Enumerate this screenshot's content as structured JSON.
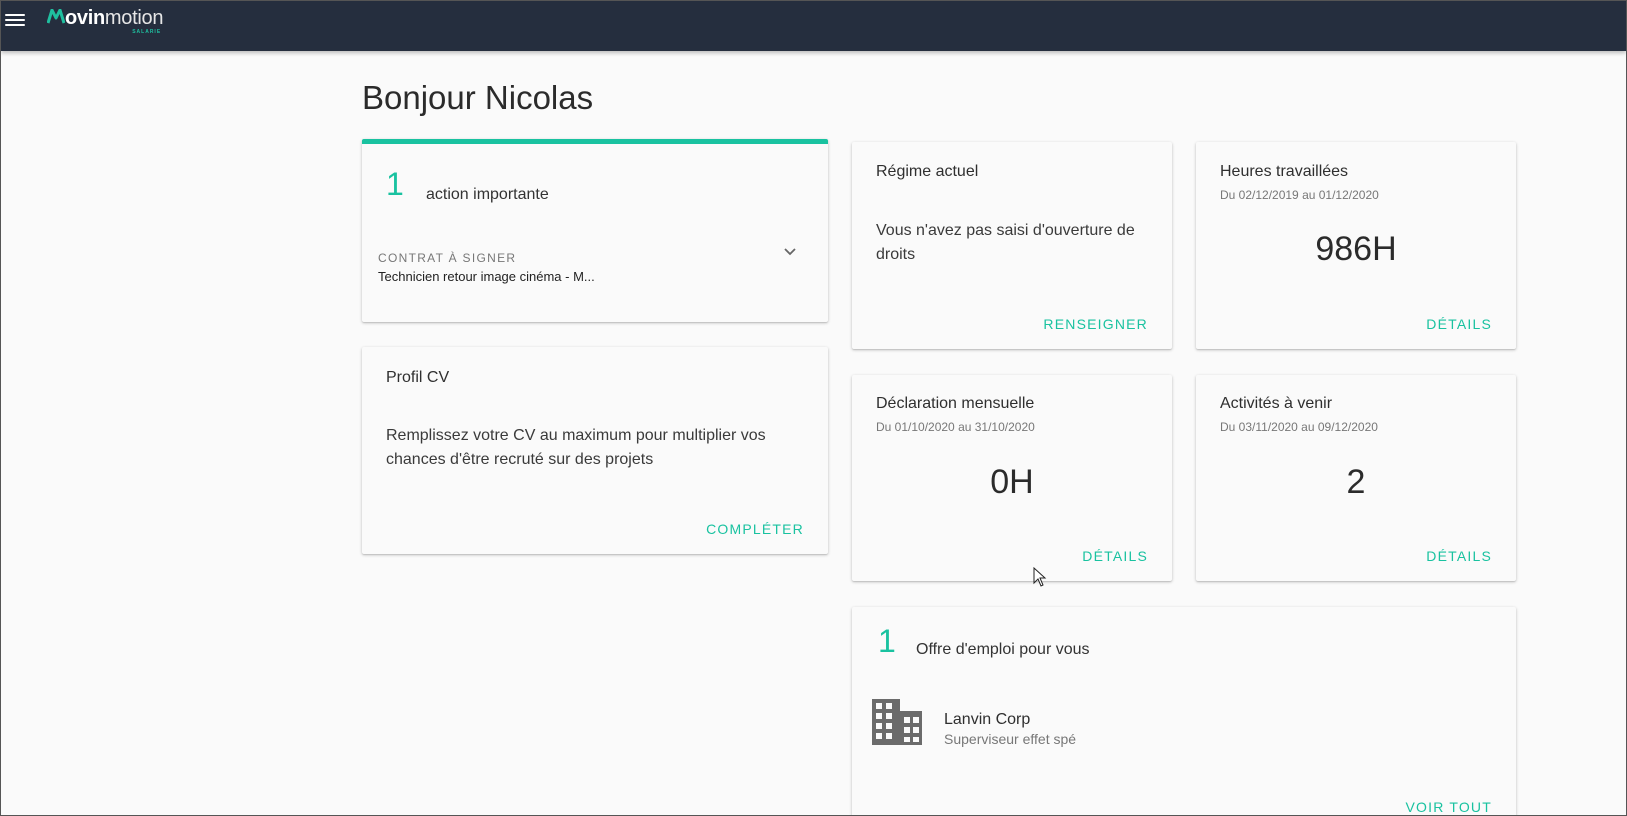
{
  "header": {
    "logo": {
      "part_bold": "ovin",
      "part_light": "motion",
      "sub": "SALARIE"
    },
    "colors": {
      "background": "#252e3e",
      "accent": "#19c2a0"
    }
  },
  "page": {
    "title": "Bonjour Nicolas"
  },
  "actions_card": {
    "count": "1",
    "label": "action importante",
    "item": {
      "eyebrow": "CONTRAT À SIGNER",
      "text": "Technicien retour image cinéma - M..."
    }
  },
  "cv_card": {
    "title": "Profil CV",
    "text": "Remplissez votre CV au maximum pour multiplier vos chances d'être recruté sur des projets",
    "action": "COMPLÉTER"
  },
  "regime_card": {
    "title": "Régime actuel",
    "text": "Vous n'avez pas saisi d'ouverture de droits",
    "action": "RENSEIGNER"
  },
  "hours_card": {
    "title": "Heures travaillées",
    "period": "Du 02/12/2019 au 01/12/2020",
    "value": "986H",
    "action": "DÉTAILS"
  },
  "declaration_card": {
    "title": "Déclaration mensuelle",
    "period": "Du 01/10/2020 au 31/10/2020",
    "value": "0H",
    "action": "DÉTAILS"
  },
  "activities_card": {
    "title": "Activités à venir",
    "period": "Du 03/11/2020 au 09/12/2020",
    "value": "2",
    "action": "DÉTAILS"
  },
  "jobs_card": {
    "count": "1",
    "label": "Offre d'emploi pour vous",
    "offer": {
      "company": "Lanvin Corp",
      "title": "Superviseur effet spé",
      "icon": "building-icon"
    },
    "action": "VOIR TOUT"
  }
}
